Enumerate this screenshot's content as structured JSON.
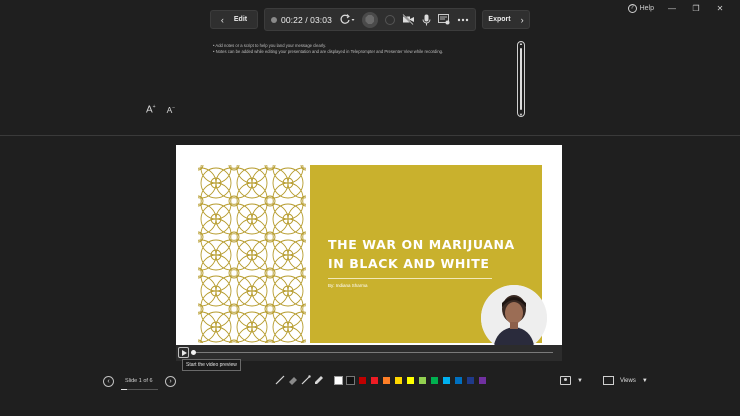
{
  "window": {
    "help_label": "Help",
    "minimize_glyph": "—",
    "restore_glyph": "❐",
    "close_glyph": "✕"
  },
  "toolbar": {
    "edit_label": "Edit",
    "export_label": "Export",
    "timer": "00:22 / 03:03",
    "reset_dropdown_glyph": "▾"
  },
  "notes": {
    "lines": [
      "• Add notes or a script to help you land your message clearly.",
      "• Notes can be added while editing your presentation and are displayed in Teleprompter and Presenter View while recording."
    ]
  },
  "font_controls": {
    "increase": "A",
    "decrease": "A"
  },
  "slide": {
    "title_line1": "THE WAR ON MARIJUANA",
    "title_line2": "IN BLACK AND WHITE",
    "byline": "By: Indiana Sharma",
    "colors": {
      "gold": "#c9b12d",
      "pattern": "#b59a2a"
    }
  },
  "video": {
    "tooltip": "Start the video preview"
  },
  "navigation": {
    "slide_counter": "Slide 1 of 6"
  },
  "ink": {
    "swatches": [
      "#ffffff",
      "#111111",
      "#c00000",
      "#ee1c25",
      "#ff7f27",
      "#ffd700",
      "#ffff00",
      "#92d050",
      "#00b050",
      "#00b0f0",
      "#0070c0",
      "#1f3a8a",
      "#7030a0"
    ]
  },
  "views": {
    "label": "Views"
  }
}
